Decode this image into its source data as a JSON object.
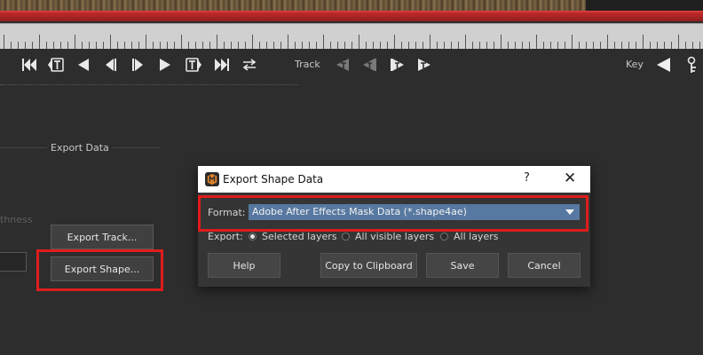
{
  "toolbar": {
    "track_label": "Track",
    "key_label": "Key"
  },
  "export_panel": {
    "section_title": "Export Data",
    "thickness_partial_label": "thness",
    "export_track_button": "Export Track...",
    "export_shape_button": "Export Shape..."
  },
  "dialog": {
    "title": "Export Shape Data",
    "help_glyph": "?",
    "close_glyph": "✕",
    "format_label": "Format:",
    "format_value": "Adobe After Effects Mask Data (*.shape4ae)",
    "export_label": "Export:",
    "export_options": [
      {
        "label": "Selected layers",
        "selected": true
      },
      {
        "label": "All visible layers",
        "selected": false
      },
      {
        "label": "All layers",
        "selected": false
      }
    ],
    "buttons": {
      "help": "Help",
      "copy": "Copy to Clipboard",
      "save": "Save",
      "cancel": "Cancel"
    }
  },
  "colors": {
    "highlight": "#e01c1c",
    "select_bg": "#5778a0",
    "timeline_bar": "#c12a2a"
  }
}
